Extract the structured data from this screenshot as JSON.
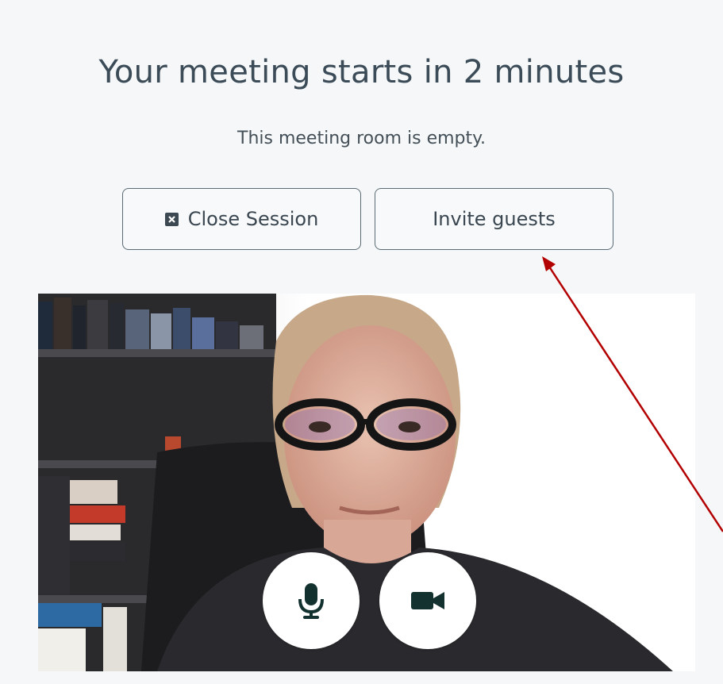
{
  "heading": {
    "title": "Your meeting starts in 2 minutes",
    "subtitle": "This meeting room is empty."
  },
  "actions": {
    "close_label": "Close Session",
    "invite_label": "Invite guests"
  },
  "video": {
    "controls": [
      {
        "icon": "microphone-icon"
      },
      {
        "icon": "video-camera-icon"
      }
    ]
  },
  "colors": {
    "background": "#f5f7f8",
    "text": "#3b4b57",
    "icon": "#12312f",
    "annotation_arrow": "#b30000"
  }
}
